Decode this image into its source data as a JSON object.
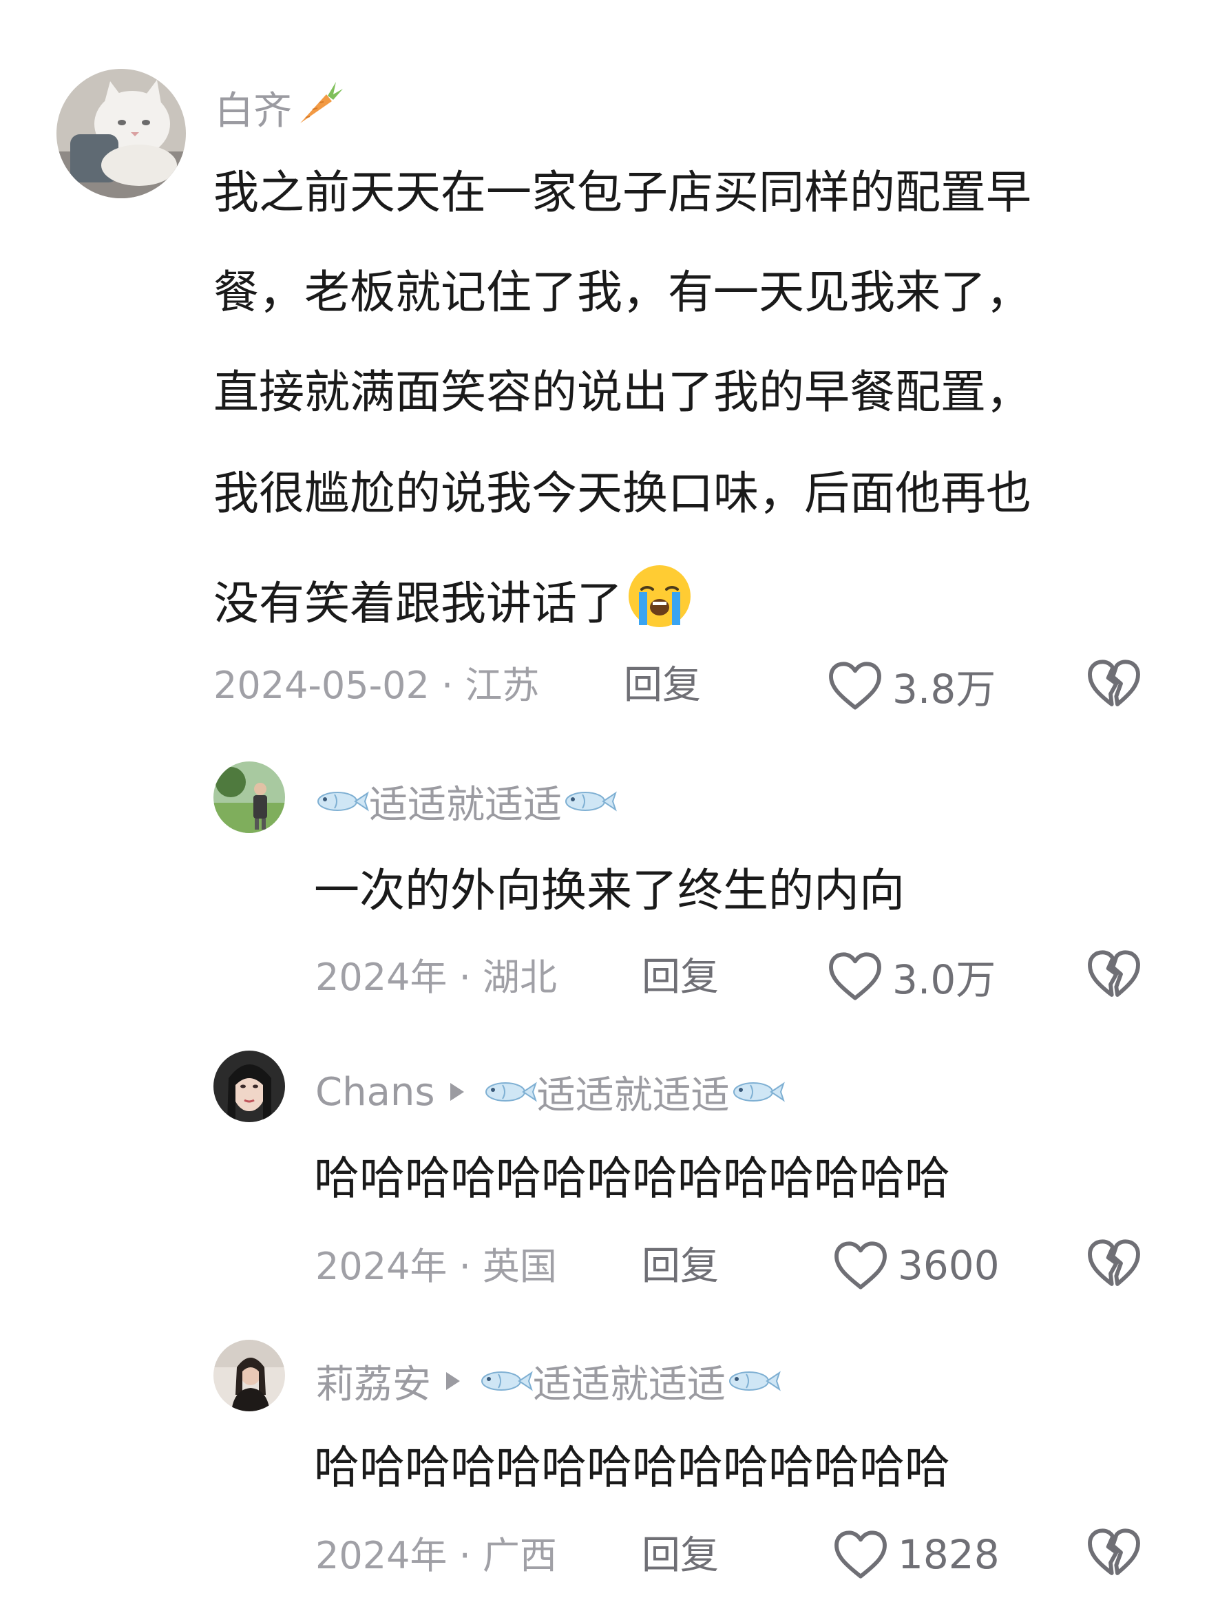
{
  "main": {
    "author": "白齐",
    "lines": [
      "我之前天天在一家包子店买同样的配置早",
      "餐，老板就记住了我，有一天见我来了，",
      "直接就满面笑容的说出了我的早餐配置，",
      "我很尴尬的说我今天换口味，后面他再也",
      "没有笑着跟我讲话了"
    ],
    "date_location": "2024-05-02 · 江苏",
    "reply_label": "回复",
    "likes": "3.8万"
  },
  "replies": [
    {
      "author": "适适就适适",
      "text": "一次的外向换来了终生的内向",
      "date_location": "2024年 · 湖北",
      "reply_label": "回复",
      "likes": "3.0万"
    },
    {
      "author": "Chans",
      "reply_to": "适适就适适",
      "text": "哈哈哈哈哈哈哈哈哈哈哈哈哈哈",
      "date_location": "2024年 · 英国",
      "reply_label": "回复",
      "likes": "3600"
    },
    {
      "author": "莉荔安",
      "reply_to": "适适就适适",
      "text": "哈哈哈哈哈哈哈哈哈哈哈哈哈哈",
      "date_location": "2024年 · 广西",
      "reply_label": "回复",
      "likes": "1828"
    }
  ],
  "icons": {
    "author_badge": "carrot-icon",
    "crying_emoji": "loudly-crying-face-icon",
    "fish": "fish-icon",
    "reply_arrow": "triangle-right-icon",
    "like": "heart-outline-icon",
    "dislike": "broken-heart-icon"
  },
  "colors": {
    "name": "#9b9ba1",
    "text": "#1a1a1a",
    "meta": "#a0a0a6",
    "action": "#6f6f75"
  }
}
